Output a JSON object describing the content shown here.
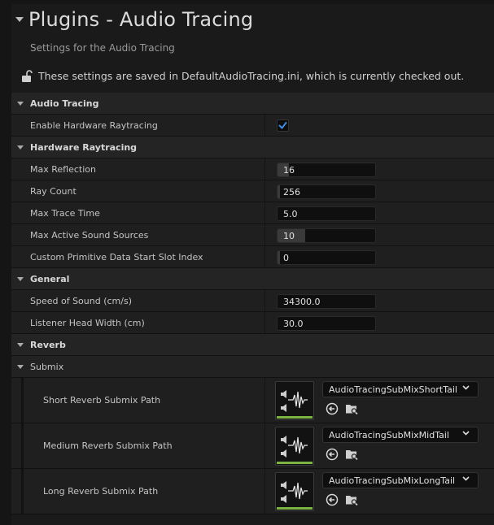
{
  "header": {
    "title": "Plugins - Audio Tracing",
    "subtitle": "Settings for the Audio Tracing",
    "notice": "These settings are saved in DefaultAudioTracing.ini, which is currently checked out."
  },
  "sections": {
    "audio_tracing": {
      "label": "Audio Tracing",
      "enable_hw_label": "Enable Hardware Raytracing",
      "enable_hw_checked": true
    },
    "hardware_raytracing": {
      "label": "Hardware Raytracing",
      "max_reflection": {
        "label": "Max Reflection",
        "value": "16"
      },
      "ray_count": {
        "label": "Ray Count",
        "value": "256"
      },
      "max_trace_time": {
        "label": "Max Trace Time",
        "value": "5.0"
      },
      "max_active_sources": {
        "label": "Max Active Sound Sources",
        "value": "10"
      },
      "custom_primitive": {
        "label": "Custom Primitive Data Start Slot Index",
        "value": "0"
      }
    },
    "general": {
      "label": "General",
      "speed_of_sound": {
        "label": "Speed of Sound (cm/s)",
        "value": "34300.0"
      },
      "listener_head_width": {
        "label": "Listener Head Width (cm)",
        "value": "30.0"
      }
    },
    "reverb": {
      "label": "Reverb"
    },
    "submix": {
      "label": "Submix",
      "short": {
        "label": "Short Reverb Submix Path",
        "value": "AudioTracingSubMixShortTail"
      },
      "medium": {
        "label": "Medium Reverb Submix Path",
        "value": "AudioTracingSubMixMidTail"
      },
      "long": {
        "label": "Long Reverb Submix Path",
        "value": "AudioTracingSubMixLongTail"
      }
    }
  },
  "colors": {
    "accent": "#3d8de6",
    "asset_bar": "#7cb342"
  },
  "icons": {
    "lock": "unlock-icon",
    "checkbox": "checkmark-icon",
    "browse": "browse-icon",
    "use": "use-selected-icon",
    "asset": "sound-submix-icon",
    "dropdown": "chevron-down-icon"
  }
}
